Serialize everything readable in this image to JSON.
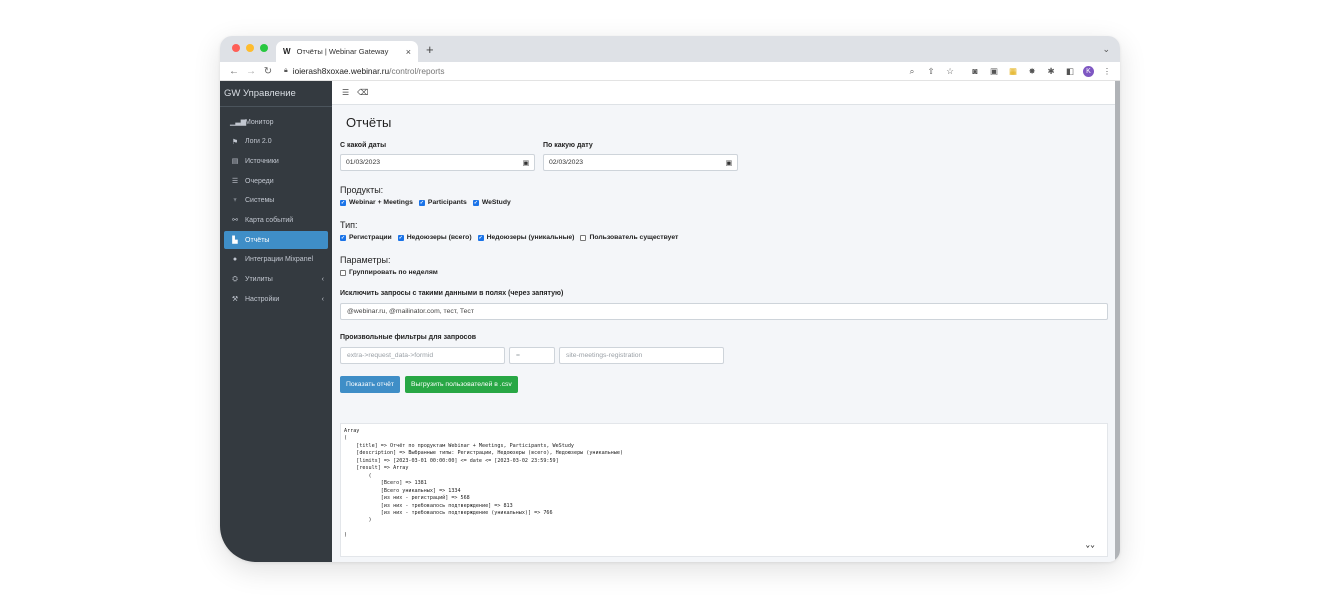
{
  "browser": {
    "tab_favicon": "W",
    "tab_title": "Отчёты | Webinar Gateway",
    "tab_close": "×",
    "new_tab": "+",
    "url_host": "ioierash8xoxae.webinar.ru",
    "url_path": "/control/reports",
    "avatar_letter": "K"
  },
  "sidebar": {
    "brand": "GW Управление",
    "items": [
      {
        "label": "Монитор",
        "icon": "bar-chart-icon"
      },
      {
        "label": "Логи 2.0",
        "icon": "flag-icon"
      },
      {
        "label": "Источники",
        "icon": "id-card-icon"
      },
      {
        "label": "Очереди",
        "icon": "list-icon"
      },
      {
        "label": "Системы",
        "icon": "plug-icon"
      },
      {
        "label": "Карта событий",
        "icon": "sitemap-icon"
      },
      {
        "label": "Отчёты",
        "icon": "file-export-icon"
      },
      {
        "label": "Интеграции Mixpanel",
        "icon": "circle-icon"
      },
      {
        "label": "Утилиты",
        "icon": "toolbox-icon"
      },
      {
        "label": "Настройки",
        "icon": "wrench-icon"
      }
    ]
  },
  "main": {
    "title": "Отчёты",
    "date_from_label": "С какой даты",
    "date_from_value": "01/03/2023",
    "date_to_label": "По какую дату",
    "date_to_value": "02/03/2023",
    "products_label": "Продукты:",
    "products": [
      {
        "label": "Webinar + Meetings",
        "checked": true
      },
      {
        "label": "Participants",
        "checked": true
      },
      {
        "label": "WeStudy",
        "checked": true
      }
    ],
    "type_label": "Тип:",
    "types": [
      {
        "label": "Регистрации",
        "checked": true
      },
      {
        "label": "Недоюзеры (всего)",
        "checked": true
      },
      {
        "label": "Недоюзеры (уникальные)",
        "checked": true
      },
      {
        "label": "Пользователь существует",
        "checked": false
      }
    ],
    "params_label": "Параметры:",
    "group_weeks": {
      "label": "Группировать по неделям",
      "checked": false
    },
    "exclude_label": "Исключить запросы с такими данными в полях (через запятую)",
    "exclude_value": "@webinar.ru, @mailinator.com, тест, Тест",
    "filters_label": "Произвольные фильтры для запросов",
    "filter_field_placeholder": "extra->request_data->formid",
    "filter_op_placeholder": "=",
    "filter_value_placeholder": "site-meetings-registration",
    "show_button": "Показать отчёт",
    "export_button": "Выгрузить пользователей в .csv",
    "output_lines": [
      "Array",
      "(",
      "    [title] => Отчёт по продуктам Webinar + Meetings, Participants, WeStudy",
      "    [description] => Выбранные типы: Регистрации, Недоюзеры (всего), Недоюзеры (уникальные)",
      "    [limits] => [2023-03-01 00:00:00] <= date <= [2023-03-02 23:59:59]",
      "    [result] => Array",
      "        (",
      "            [Всего] => 1381",
      "            [Всего уникальных] => 1334",
      "            [из них - регистраций] => 568",
      "            [из них - требовалось подтверждение] => 813",
      "            [из них - требовалось подтверждение (уникальных)] => 766",
      "        )",
      "",
      ")"
    ]
  }
}
